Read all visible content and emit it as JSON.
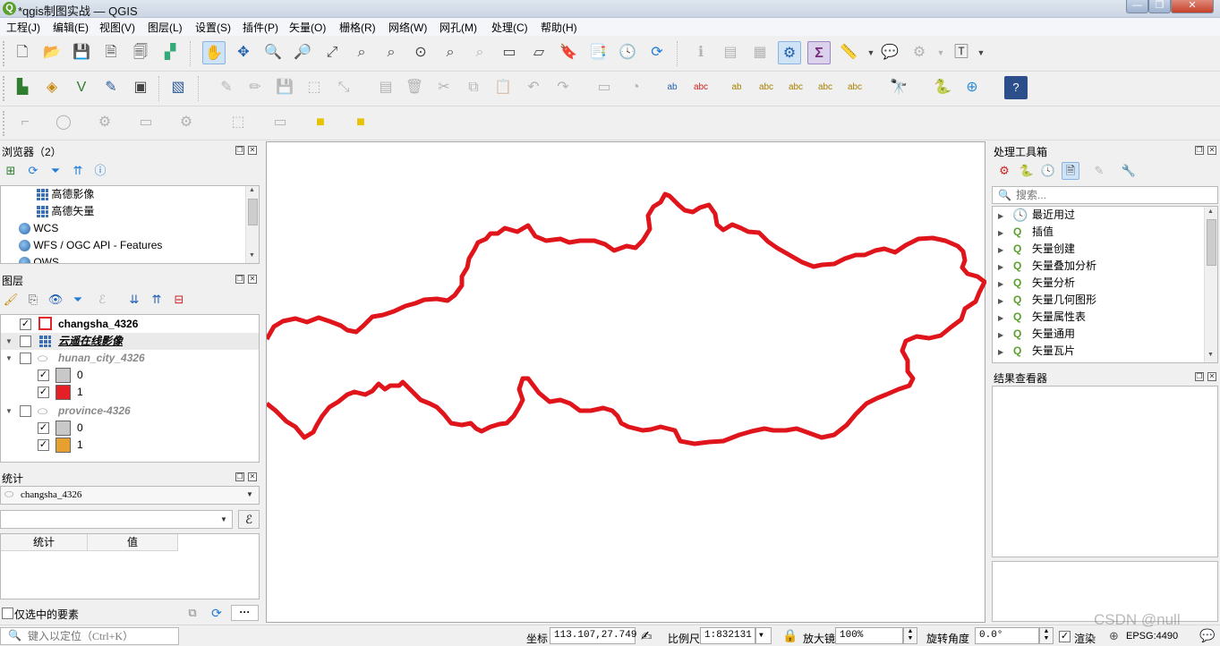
{
  "window": {
    "title": "*qgis制图实战 — QGIS",
    "min": "—",
    "max": "❐",
    "close": "✕"
  },
  "menu": [
    "工程(J)",
    "编辑(E)",
    "视图(V)",
    "图层(L)",
    "设置(S)",
    "插件(P)",
    "矢量(O)",
    "栅格(R)",
    "网络(W)",
    "网孔(M)",
    "处理(C)",
    "帮助(H)"
  ],
  "browser": {
    "title": "浏览器（2）",
    "items": [
      {
        "label": "高德影像",
        "icon": "grid-icon"
      },
      {
        "label": "高德矢量",
        "icon": "grid-icon"
      },
      {
        "label": "WCS",
        "icon": "globe-icon"
      },
      {
        "label": "WFS / OGC API - Features",
        "icon": "globe-icon"
      },
      {
        "label": "OWS",
        "icon": "globe-icon"
      }
    ]
  },
  "layers": {
    "title": "图层",
    "items": [
      {
        "label": "changsha_4326",
        "checked": true,
        "style": "bold",
        "swatch": "#ffffff",
        "swatch_border": "#e0262b"
      },
      {
        "label": "云遥在线影像",
        "checked": false,
        "style": "bold-italic-underline"
      },
      {
        "label": "hunan_city_4326",
        "checked": false,
        "style": "italic-gray"
      },
      {
        "label": "0",
        "checked": true,
        "swatch": "#c8c8c8"
      },
      {
        "label": "1",
        "checked": true,
        "swatch": "#e41f26"
      },
      {
        "label": "province-4326",
        "checked": false,
        "style": "italic-gray"
      },
      {
        "label": "0",
        "checked": true,
        "swatch": "#c8c8c8"
      },
      {
        "label": "1",
        "checked": true,
        "swatch": "#e6a030"
      }
    ]
  },
  "stats": {
    "title": "统计",
    "layer": "changsha_4326",
    "col_stat": "统计",
    "col_value": "值",
    "selected_only": "仅选中的要素",
    "epsilon": "ℰ"
  },
  "processing": {
    "title": "处理工具箱",
    "search_placeholder": "搜索...",
    "items": [
      "最近用过",
      "插值",
      "矢量创建",
      "矢量叠加分析",
      "矢量分析",
      "矢量几何图形",
      "矢量属性表",
      "矢量通用",
      "矢量瓦片"
    ]
  },
  "results": {
    "title": "结果查看器"
  },
  "locator": {
    "placeholder": "键入以定位（Ctrl+K）"
  },
  "status": {
    "coord_label": "坐标",
    "coord_value": "113.107,27.749",
    "scale_label": "比例尺",
    "scale_value": "1:832131",
    "magnifier_label": "放大镜",
    "magnifier_value": "100%",
    "rotation_label": "旋转角度",
    "rotation_value": "0.0°",
    "render_label": "渲染",
    "crs": "EPSG:4490",
    "watermark": "CSDN @null"
  },
  "colors": {
    "boundary": "#e0151c"
  }
}
